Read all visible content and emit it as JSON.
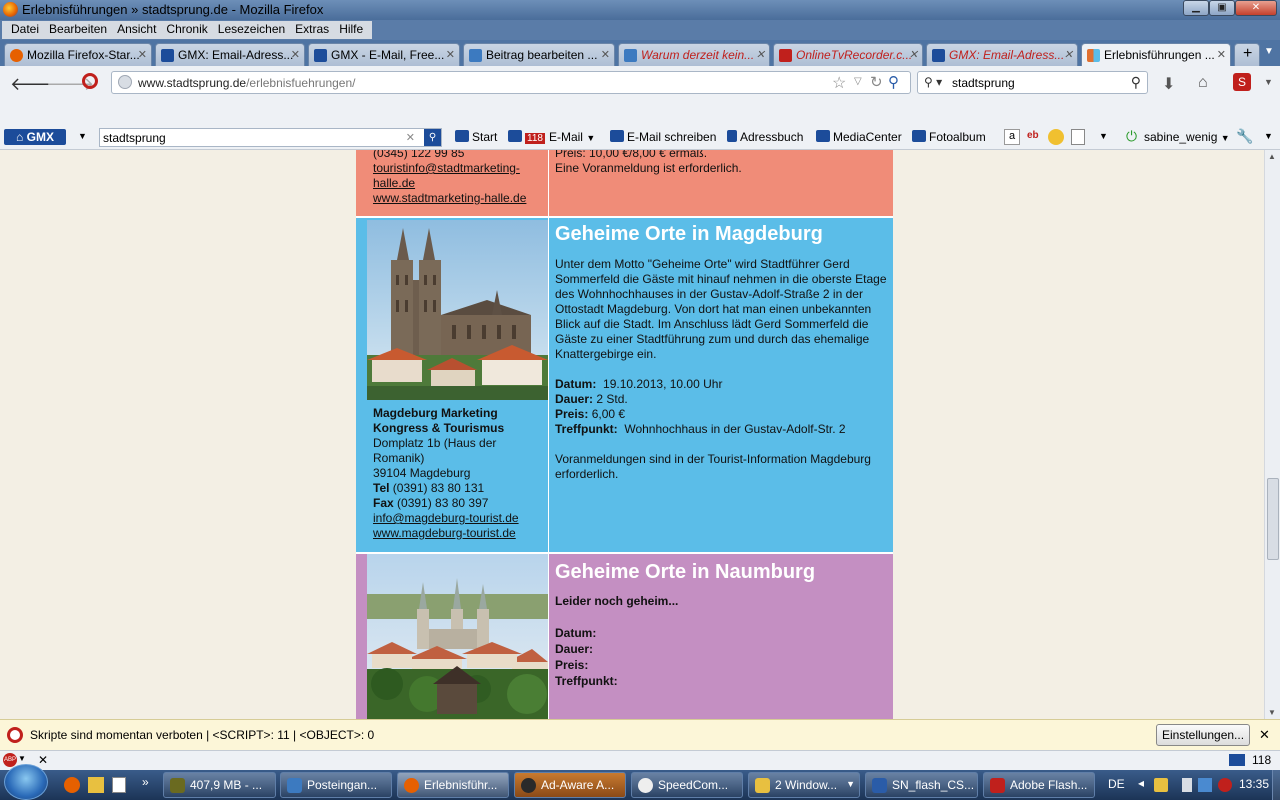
{
  "window": {
    "title": "Erlebnisführungen » stadtsprung.de - Mozilla Firefox"
  },
  "menu": [
    "Datei",
    "Bearbeiten",
    "Ansicht",
    "Chronik",
    "Lesezeichen",
    "Extras",
    "Hilfe"
  ],
  "tabs": [
    {
      "label": "Mozilla Firefox-Star...",
      "icon_color": "#e66000"
    },
    {
      "label": "GMX: Email-Adress...",
      "icon_color": "#1c4c9a"
    },
    {
      "label": "GMX - E-Mail, Free...",
      "icon_color": "#1c4c9a"
    },
    {
      "label": "Beitrag bearbeiten ...",
      "icon_color": "#3c7ac0"
    },
    {
      "label": "Warum derzeit kein...",
      "icon_color": "#3c7ac0"
    },
    {
      "label": "OnlineTvRecorder.c...",
      "icon_color": "#c0201c"
    },
    {
      "label": "GMX: Email-Adress...",
      "icon_color": "#1c4c9a"
    },
    {
      "label": "Erlebnisführungen ...",
      "icon_color": "#e07030"
    }
  ],
  "nav": {
    "url_host": "www.stadtsprung.de",
    "url_path": "/erlebnisfuehrungen/",
    "search_value": "stadtsprung"
  },
  "gmx": {
    "logo": "GMX",
    "search_value": "stadtsprung",
    "start": "Start",
    "email": "E-Mail",
    "email_badge": "118",
    "email_write": "E-Mail schreiben",
    "addressbook": "Adressbuch",
    "mediacenter": "MediaCenter",
    "fotoalbum": "Fotoalbum",
    "user": "sabine_wenig"
  },
  "halle": {
    "tel_partial": "(0345) 122 99 85",
    "email": "touristinfo@stadtmarketing-halle.de",
    "email_line1": "touristinfo@stadtmarketing-",
    "email_line2": "halle.de",
    "web": "www.stadtmarketing-halle.de",
    "price_partial": "Preis: 10,00 €/8,00 € ermäß.",
    "note": "Eine Voranmeldung ist erforderlich."
  },
  "magdeburg": {
    "heading": "Geheime Orte in Magdeburg",
    "description": "Unter dem Motto \"Geheime Orte\" wird Stadtführer Gerd Sommerfeld die Gäste mit hinauf nehmen in die oberste Etage des Wohnhochhauses in der Gustav-Adolf-Straße 2 in der Ottostadt Magdeburg. Von dort hat man einen unbekannten Blick auf die Stadt. Im Anschluss lädt Gerd Sommerfeld die Gäste zu einer Stadtführung zum und durch das ehemalige Knattergebirge ein.",
    "datum_label": "Datum:",
    "datum": "19.10.2013, 10.00 Uhr",
    "dauer_label": "Dauer:",
    "dauer": "2 Std.",
    "preis_label": "Preis:",
    "preis": "6,00 €",
    "treffpunkt_label": "Treffpunkt:",
    "treffpunkt": "Wohnhochhaus in der Gustav-Adolf-Str. 2",
    "anmeldung": "Voranmeldungen sind in der Tourist-Information Magdeburg erforderlich.",
    "org_line1": "Magdeburg Marketing",
    "org_line2": "Kongress & Tourismus",
    "address1": "Domplatz 1b (Haus der",
    "address2": "Romanik)",
    "address3": "39104 Magdeburg",
    "tel_label": "Tel",
    "tel": "(0391) 83 80 131",
    "fax_label": "Fax",
    "fax": "(0391) 83 80 397",
    "email": "info@magdeburg-tourist.de",
    "web": "www.magdeburg-tourist.de"
  },
  "naumburg": {
    "heading": "Geheime Orte in Naumburg",
    "teaser": "Leider noch geheim...",
    "datum_label": "Datum:",
    "dauer_label": "Dauer:",
    "preis_label": "Preis:",
    "treffpunkt_label": "Treffpunkt:"
  },
  "notification": {
    "text": "Skripte sind momentan verboten | <SCRIPT>: 11 | <OBJECT>: 0",
    "button": "Einstellungen..."
  },
  "addonbar": {
    "count": "118"
  },
  "taskbar": {
    "items": [
      {
        "label": "407,9 MB - ...",
        "icon_color": "#6a6a20"
      },
      {
        "label": "Posteingan...",
        "icon_color": "#3c7ac0"
      },
      {
        "label": "Erlebnisführ...",
        "icon_color": "#e66000"
      },
      {
        "label": "Ad-Aware A...",
        "icon_color": "#2a2a2a"
      },
      {
        "label": "SpeedCom...",
        "icon_color": "#eeeeee"
      },
      {
        "label": "2 Window...",
        "icon_color": "#e8c040"
      },
      {
        "label": "SN_flash_CS...",
        "icon_color": "#2a5ca8"
      },
      {
        "label": "Adobe Flash...",
        "icon_color": "#c0201c"
      }
    ],
    "language": "DE",
    "time": "13:35"
  }
}
